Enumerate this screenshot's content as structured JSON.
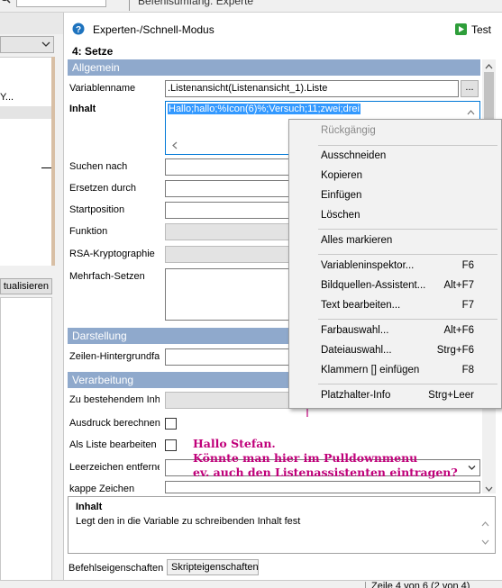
{
  "top": {
    "tab_label": "Befehlsumfang: Experte"
  },
  "header": {
    "mode_title": "Experten-/Schnell-Modus",
    "test_label": "Test",
    "step_title": "4: Setze"
  },
  "left_panel": {
    "clip_text": "Y...",
    "button_partial": "tualisieren"
  },
  "sections": {
    "allgemein": "Allgemein",
    "darstellung": "Darstellung",
    "verarbeitung": "Verarbeitung"
  },
  "form": {
    "variablenname_label": "Variablenname",
    "variablenname_value": ".Listenansicht(Listenansicht_1).Liste",
    "browse_label": "...",
    "inhalt_label": "Inhalt",
    "inhalt_value": "Hallo;hallo;%Icon(6)%;Versuch;11;zwei;drei",
    "suchen_label": "Suchen nach",
    "ersetzen_label": "Ersetzen durch",
    "startposition_label": "Startposition",
    "funktion_label": "Funktion",
    "rsa_label": "RSA-Kryptographie",
    "mehrfach_label": "Mehrfach-Setzen",
    "zeilen_label": "Zeilen-Hintergrundfarl",
    "bestehend_label": "Zu bestehendem Inha",
    "ausdruck_label": "Ausdruck berechnen",
    "liste_label": "Als Liste bearbeiten",
    "leerzeichen_label": "Leerzeichen entferne",
    "kappe_label": "kappe Zeichen"
  },
  "context_menu": {
    "items": [
      {
        "label": "Rückgängig",
        "shortcut": "",
        "disabled": true
      },
      {
        "label": "Ausschneiden",
        "shortcut": ""
      },
      {
        "label": "Kopieren",
        "shortcut": ""
      },
      {
        "label": "Einfügen",
        "shortcut": ""
      },
      {
        "label": "Löschen",
        "shortcut": ""
      },
      {
        "label": "Alles markieren",
        "shortcut": ""
      },
      {
        "label": "Variableninspektor...",
        "shortcut": "F6"
      },
      {
        "label": "Bildquellen-Assistent...",
        "shortcut": "Alt+F7"
      },
      {
        "label": "Text bearbeiten...",
        "shortcut": "F7"
      },
      {
        "label": "Farbauswahl...",
        "shortcut": "Alt+F6"
      },
      {
        "label": "Dateiauswahl...",
        "shortcut": "Strg+F6"
      },
      {
        "label": "Klammern [] einfügen",
        "shortcut": "F8"
      },
      {
        "label": "Platzhalter-Info",
        "shortcut": "Strg+Leer"
      }
    ]
  },
  "annotation": {
    "line1": "Hallo Stefan.",
    "line2": "Könnte man hier im Pulldownmenu",
    "line3": "ev. auch den Listenassistenten eintragen?",
    "color": "#c0007a"
  },
  "help": {
    "title": "Inhalt",
    "text": "Legt den in die Variable zu schreibenden Inhalt fest"
  },
  "bottom_tabs": {
    "tab1": "Befehlseigenschaften",
    "tab2": "Skripteigenschaften"
  },
  "status": {
    "row_info": "Zeile 4 von 6 (2 von 4)"
  },
  "colors": {
    "section_header": "#8fa9cc",
    "selection": "#3399ff",
    "accent_help": "#1e73be",
    "test_green": "#2e9e3a"
  }
}
